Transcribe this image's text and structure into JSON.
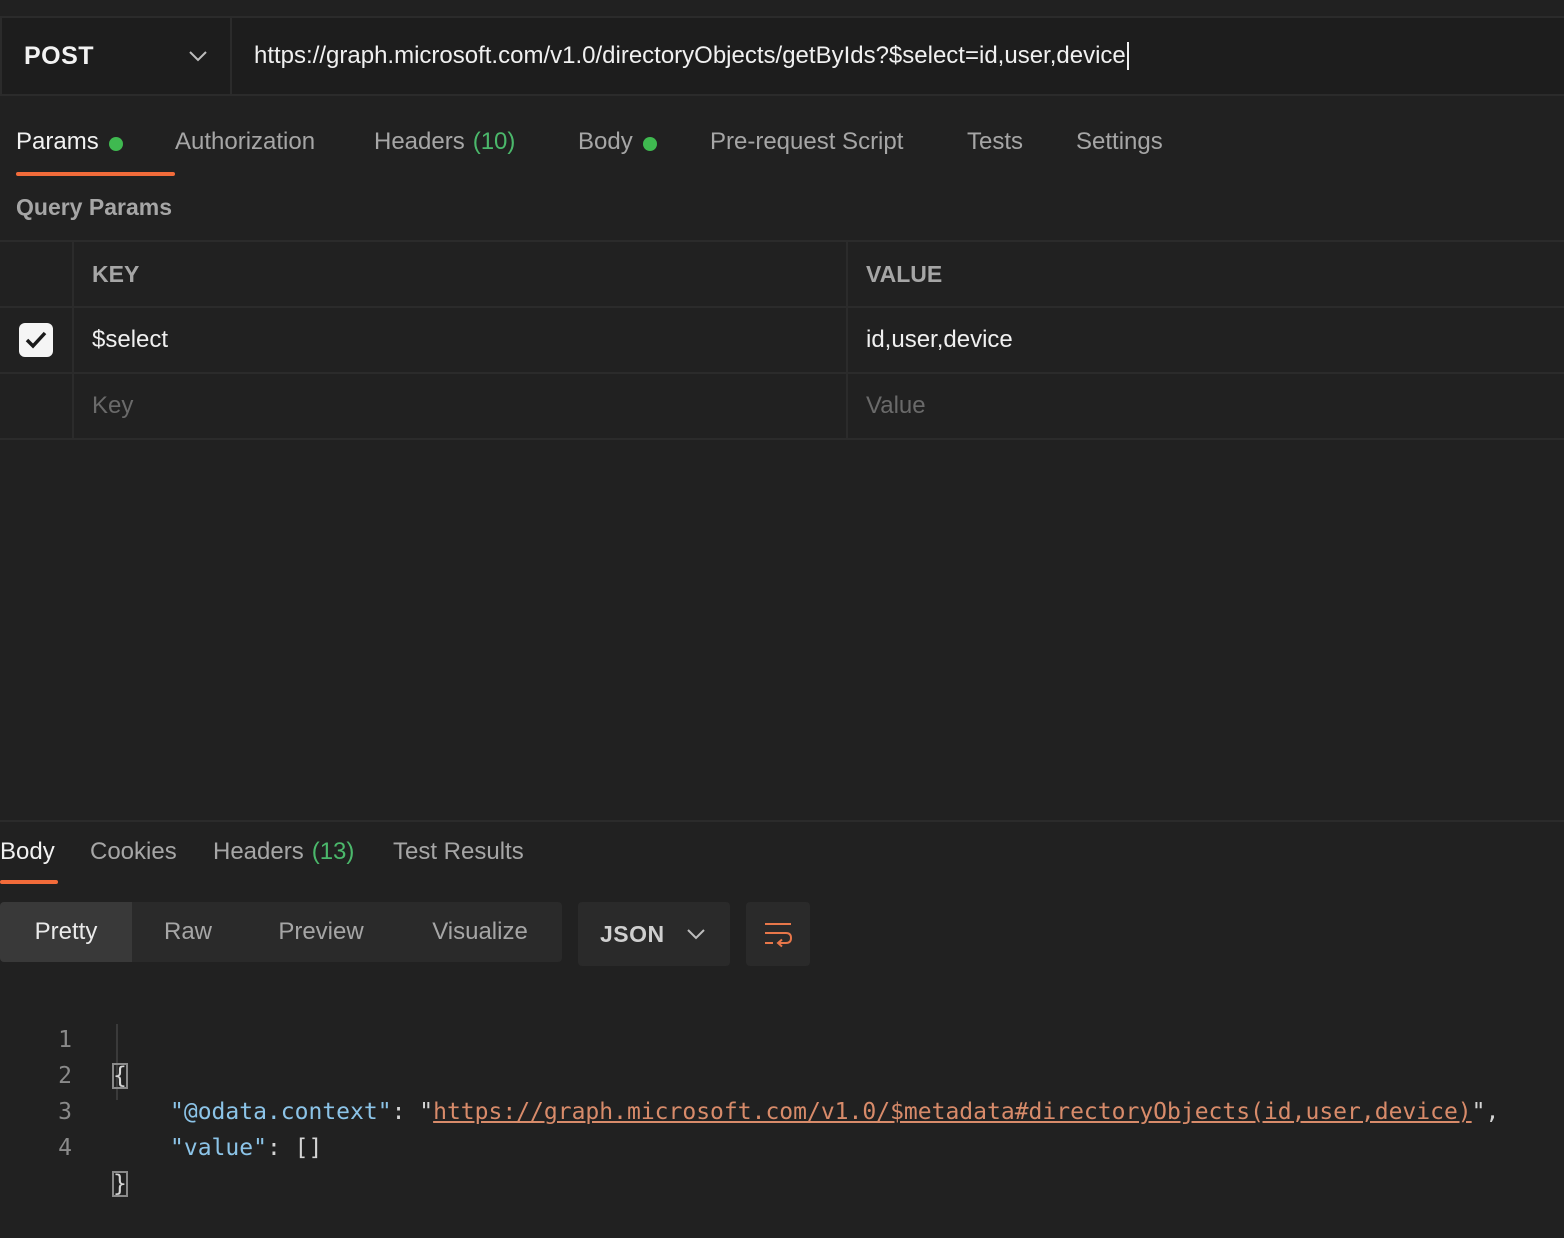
{
  "request": {
    "method": "POST",
    "url": "https://graph.microsoft.com/v1.0/directoryObjects/getByIds?$select=id,user,device"
  },
  "request_tabs": {
    "params": "Params",
    "authorization": "Authorization",
    "headers": "Headers",
    "headers_count": "(10)",
    "body": "Body",
    "prerequest": "Pre-request Script",
    "tests": "Tests",
    "settings": "Settings"
  },
  "query_params": {
    "title": "Query Params",
    "key_header": "KEY",
    "value_header": "VALUE",
    "rows": [
      {
        "key": "$select",
        "value": "id,user,device",
        "checked": true
      }
    ],
    "key_placeholder": "Key",
    "value_placeholder": "Value"
  },
  "response_tabs": {
    "body": "Body",
    "cookies": "Cookies",
    "headers": "Headers",
    "headers_count": "(13)",
    "test_results": "Test Results"
  },
  "view_modes": {
    "pretty": "Pretty",
    "raw": "Raw",
    "preview": "Preview",
    "visualize": "Visualize"
  },
  "format": "JSON",
  "response_body": {
    "line_numbers": [
      "1",
      "2",
      "3",
      "4"
    ],
    "open_brace": "{",
    "close_brace": "}",
    "context_key": "\"@odata.context\"",
    "context_value": "https://graph.microsoft.com/v1.0/$metadata#directoryObjects(id,user,device)",
    "value_key": "\"value\"",
    "value_value": "[]"
  },
  "colors": {
    "accent": "#f26b3a",
    "green": "#3fb950",
    "background": "#212121"
  }
}
